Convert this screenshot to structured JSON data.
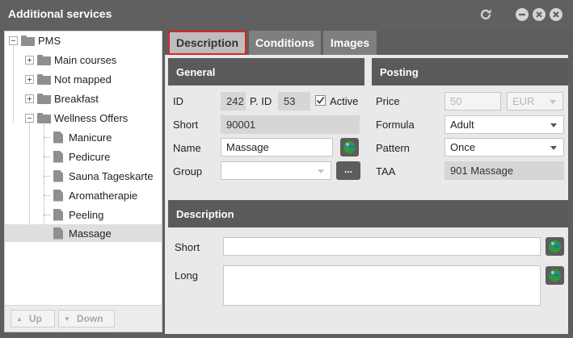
{
  "window": {
    "title": "Additional services"
  },
  "tree": {
    "root": "PMS",
    "items": [
      {
        "label": "Main courses",
        "icon": "folder-icon"
      },
      {
        "label": "Not mapped",
        "icon": "folder-icon"
      },
      {
        "label": "Breakfast",
        "icon": "folder-icon"
      },
      {
        "label": "Wellness Offers",
        "icon": "folder-open-icon"
      },
      {
        "label": "Manicure",
        "icon": "document-icon"
      },
      {
        "label": "Pedicure",
        "icon": "document-icon"
      },
      {
        "label": "Sauna Tageskarte",
        "icon": "document-icon"
      },
      {
        "label": "Aromatherapie",
        "icon": "document-icon"
      },
      {
        "label": "Peeling",
        "icon": "document-icon"
      },
      {
        "label": "Massage",
        "icon": "document-icon",
        "selected": true
      }
    ],
    "up_label": "Up",
    "down_label": "Down"
  },
  "tabs": [
    "Description",
    "Conditions",
    "Images"
  ],
  "general": {
    "header": "General",
    "id_label": "ID",
    "id_value": "242",
    "pid_label": "P. ID",
    "pid_value": "53",
    "active_label": "Active",
    "active_checked": true,
    "short_label": "Short",
    "short_value": "90001",
    "name_label": "Name",
    "name_value": "Massage",
    "group_label": "Group",
    "group_value": "",
    "group_button": "..."
  },
  "posting": {
    "header": "Posting",
    "price_label": "Price",
    "price_value": "50",
    "currency_value": "EUR",
    "formula_label": "Formula",
    "formula_value": "Adult",
    "pattern_label": "Pattern",
    "pattern_value": "Once",
    "taa_label": "TAA",
    "taa_value": "901 Massage"
  },
  "description": {
    "header": "Description",
    "short_label": "Short",
    "short_value": "",
    "long_label": "Long",
    "long_value": ""
  },
  "colors": {
    "accent_tab_border": "#dd2222",
    "header_bg": "#5a5a5a",
    "title_bar": "#606060"
  }
}
